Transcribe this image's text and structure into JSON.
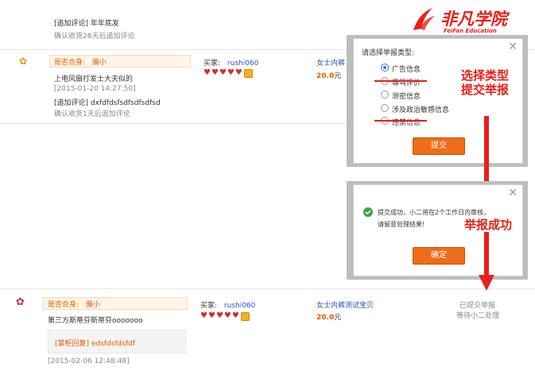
{
  "top_review": {
    "followup_title": "[追加评论] 年年底发",
    "followup_meta": "确认收货28天后追加评论"
  },
  "review1": {
    "fit_label": "是否合身:",
    "fit_value": "偏小",
    "content": "上电风扇打发士大夫似的",
    "date": "[2015-01-20 14:27:50]",
    "followup_title": "[追加评论] dxfdfdsfsdfsdfsdfsd",
    "followup_meta": "确认收货1天后追加评论",
    "buyer_label": "买家:",
    "buyer_name": "rushi060",
    "product_name": "女士内裤",
    "price": "20.0",
    "price_unit": "元"
  },
  "review2": {
    "fit_label": "是否合身:",
    "fit_value": "偏小",
    "content": "第三方斯蒂芬斯蒂芬ooooooo",
    "reply": "[掌柜回复] edsfdsfdsfdf",
    "date": "[2015-02-06 12:48:48]",
    "buyer_label": "买家:",
    "buyer_name": "rushi060",
    "product_name": "女士内裤测试宝贝",
    "price": "20.0",
    "price_unit": "元",
    "status_line1": "已提交举报",
    "status_line2": "等待小二处理"
  },
  "report_modal": {
    "title": "请选择举报类型:",
    "options": [
      "广告信息",
      "辱骂评价",
      "泄密信息",
      "涉及政治敏感信息",
      "违禁信息"
    ],
    "submit_label": "提交",
    "close_label": "✕"
  },
  "success_modal": {
    "message_line1": "提交成功，小二将在2个工作日内审核，",
    "message_line2": "请留意处理结果!",
    "confirm_label": "确定",
    "close_label": "✕"
  },
  "annotations": {
    "select_line1": "选择类型",
    "select_line2": "提交举报",
    "success": "举报成功"
  },
  "logo": {
    "text": "非凡学院",
    "subtitle": "FeiFan Education"
  },
  "colors": {
    "accent_orange": "#ef6c1a",
    "annotation_red": "#e8201a",
    "link_blue": "#2a55b5",
    "success_green": "#3aa53a"
  }
}
